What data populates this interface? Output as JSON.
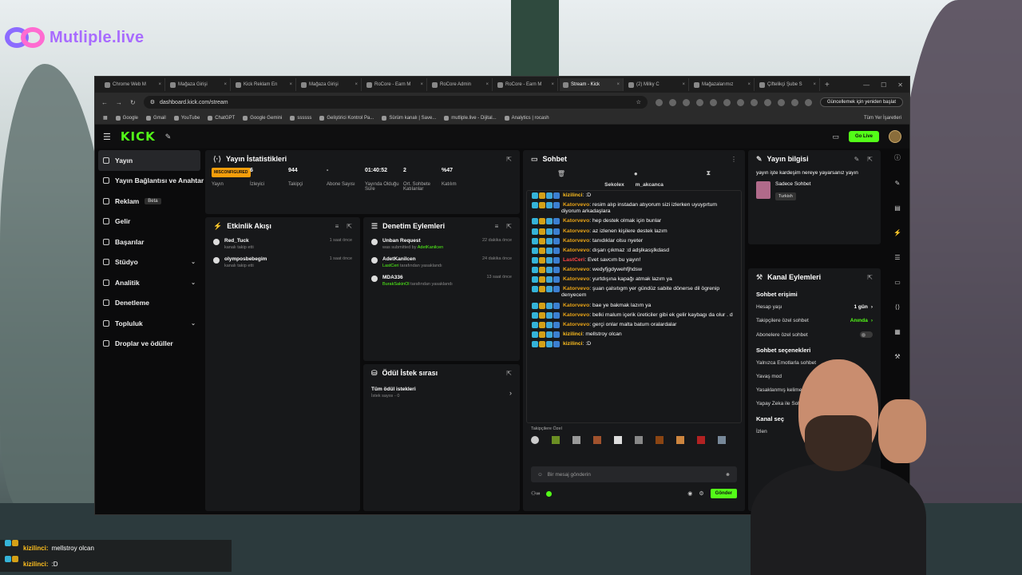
{
  "overlay_logo": "Mutliple.live",
  "browser": {
    "tabs": [
      {
        "label": "Chrome Web M",
        "active": false
      },
      {
        "label": "Mağaza Girişi",
        "active": false
      },
      {
        "label": "Kick Reklam En",
        "active": false
      },
      {
        "label": "Mağaza Girişi",
        "active": false
      },
      {
        "label": "RoCore - Earn M",
        "active": false
      },
      {
        "label": "RoCore Admin",
        "active": false
      },
      {
        "label": "RoCore - Earn M",
        "active": false
      },
      {
        "label": "Stream - Kick",
        "active": true
      },
      {
        "label": "(2) Milky C",
        "active": false
      },
      {
        "label": "Mağazalarımız",
        "active": false
      },
      {
        "label": "Çiftelikçi Şube S",
        "active": false
      }
    ],
    "url": "dashboard.kick.com/stream",
    "update_button": "Güncellemek için yeniden başlat",
    "bookmarks": [
      "Google",
      "Gmail",
      "YouTube",
      "ChatGPT",
      "Google Gemini",
      "ssssss",
      "Geliştirici Kontrol Pa...",
      "Sürüm kanalı | Save...",
      "mutliple.live - Dijital...",
      "Analytics | rocash"
    ],
    "all_bookmarks": "Tüm Yer İşaretleri"
  },
  "kick": {
    "logo": "KICK",
    "go_live": "Go Live",
    "sidebar": [
      {
        "label": "Yayın",
        "active": true,
        "icon": "broadcast-icon"
      },
      {
        "label": "Yayın Bağlantısı ve Anahtar",
        "icon": "link-icon"
      },
      {
        "label": "Reklam",
        "badge": "Beta",
        "icon": "ad-icon"
      },
      {
        "label": "Gelir",
        "icon": "money-icon"
      },
      {
        "label": "Başarılar",
        "icon": "trophy-icon"
      },
      {
        "label": "Stüdyo",
        "chevron": true,
        "icon": "studio-icon"
      },
      {
        "label": "Analitik",
        "chevron": true,
        "icon": "chart-icon"
      },
      {
        "label": "Denetleme",
        "icon": "hammer-icon"
      },
      {
        "label": "Topluluk",
        "chevron": true,
        "icon": "users-icon"
      },
      {
        "label": "Droplar ve ödüller",
        "icon": "gift-icon"
      }
    ],
    "stats_panel": {
      "title": "Yayın İstatistikleri",
      "items": [
        {
          "value": "MISCONFIGURED",
          "label": "Yayın",
          "badge": true
        },
        {
          "value": "6",
          "label": "İzleyici"
        },
        {
          "value": "944",
          "label": "Takipçi"
        },
        {
          "value": "-",
          "label": "Abone Sayısı"
        },
        {
          "value": "01:40:52",
          "label": "Yayında Olduğu Süre"
        },
        {
          "value": "2",
          "label": "Ort. Sohbete Katılanlar"
        },
        {
          "value": "%47",
          "label": "Katılım"
        }
      ]
    },
    "activity_panel": {
      "title": "Etkinlik Akışı",
      "items": [
        {
          "name": "Red_Tuck",
          "sub": "kanalı takip etti",
          "time": "1 saat önce"
        },
        {
          "name": "olymposbebegim",
          "sub": "kanalı takip etti",
          "time": "1 saat önce"
        }
      ]
    },
    "moderation_panel": {
      "title": "Denetim Eylemleri",
      "items": [
        {
          "name": "Unban Request",
          "sub": "was submitted by",
          "by": "AdetKanilcen",
          "time": "22 dakika önce"
        },
        {
          "name": "AdetKanilcen",
          "by": "LastCeri",
          "sub": "tarafından yasaklandı",
          "time": "24 dakika önce"
        },
        {
          "name": "MDA336",
          "by": "BurakSakinOl",
          "sub": "tarafından yasaklandı",
          "time": "13 saat önce"
        }
      ]
    },
    "reward_panel": {
      "title": "Ödül İstek sırası",
      "all_label": "Tüm ödül istekleri",
      "count_label": "İstek sayısı - 0"
    },
    "chat_panel": {
      "title": "Sohbet",
      "pinned_users": [
        "Sekolex",
        "m_akcanca"
      ],
      "messages": [
        {
          "user": "kizilinci",
          "text": ":D",
          "color": "gold"
        },
        {
          "user": "Katorvevo",
          "text": "resim alıp instadan atıyorum sizi izlerken uyuyprtum diyorum arkadaşlara",
          "color": "orange"
        },
        {
          "user": "Katorvevo",
          "text": "hep destek olmak için bunlar",
          "color": "orange"
        },
        {
          "user": "Katorvevo",
          "text": "az izlenen kişilere destek lazım",
          "color": "orange"
        },
        {
          "user": "Katorvevo",
          "text": "tanıdıklar olsu nyeter",
          "color": "orange"
        },
        {
          "user": "Katorvevo",
          "text": "dışarı çıkmaz :d adşlkasşlkdasd",
          "color": "orange"
        },
        {
          "user": "LastCeri",
          "text": "Evet savcım bu yayın!",
          "color": "red"
        },
        {
          "user": "Katorvevo",
          "text": "wedyfjgdywehfjhdsw",
          "color": "orange"
        },
        {
          "user": "Katorvevo",
          "text": "yurtdışına kapağı atmak lazım ya",
          "color": "orange"
        },
        {
          "user": "Katorvevo",
          "text": "şuan çalsıtıgm yer gündüz sabite dönerse dil ögrenip denyecem",
          "color": "orange"
        },
        {
          "user": "Katorvevo",
          "text": "bae ye bakmak lazım ya",
          "color": "orange"
        },
        {
          "user": "Katorvevo",
          "text": "belki malum içerik üreticiler gibi ek gelir kaybagı da olur . d",
          "color": "orange"
        },
        {
          "user": "Katorvevo",
          "text": "gerçi onlar malta batum oralardalar",
          "color": "orange"
        },
        {
          "user": "kizilinci",
          "text": "mellstroy olcan",
          "color": "gold"
        },
        {
          "user": "kizilinci",
          "text": ":D",
          "color": "gold"
        }
      ],
      "followers_only": "Takipçilere Özel",
      "input_placeholder": "Bir mesaj gönderin",
      "send_label": "Gönder"
    },
    "stream_info": {
      "title": "Yayın bilgisi",
      "stream_title": "yayın işte kardeşim nereye yayarsanız yayın",
      "category": "Sadece Sohbet",
      "language": "Turkish"
    },
    "channel_actions": {
      "title": "Kanal Eylemleri",
      "chat_access": "Sohbet erişimi",
      "rows": [
        {
          "label": "Hesap yaşı",
          "value": "1 gün"
        },
        {
          "label": "Takipçilere özel sohbet",
          "value": "Anında"
        },
        {
          "label": "Abonelere özel sohbet",
          "toggle": true
        }
      ],
      "chat_options": "Sohbet seçenekleri",
      "options": [
        "Yalnızca Emotlarla sohbet",
        "Yavaş mod",
        "Yasaklanmış kelimeler",
        "Yapay Zeka ile Sohbet Dene"
      ],
      "channel_section": "Kanal seç",
      "izlen": "İzlen"
    }
  },
  "overlay_chat": [
    {
      "user": "kizilinci:",
      "text": "mellstroy olcan"
    },
    {
      "user": "kizilinci:",
      "text": ":D"
    }
  ]
}
